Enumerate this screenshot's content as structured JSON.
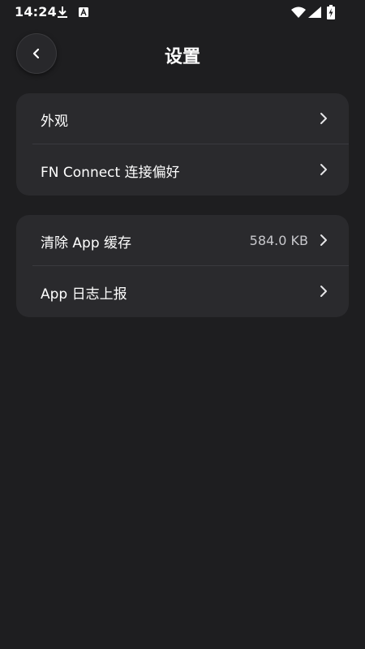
{
  "status_bar": {
    "time": "14:24",
    "icons": [
      "download-icon",
      "a-icon",
      "wifi-icon",
      "signal-icon",
      "battery-charging-icon"
    ]
  },
  "header": {
    "title": "设置",
    "back_icon": "chevron-left-icon"
  },
  "groups": [
    {
      "items": [
        {
          "label": "外观"
        },
        {
          "label": "FN Connect 连接偏好"
        }
      ]
    },
    {
      "items": [
        {
          "label": "清除 App 缓存",
          "value": "584.0 KB"
        },
        {
          "label": "App 日志上报"
        }
      ]
    }
  ],
  "colors": {
    "background": "#1e1e20",
    "card": "#2a2a2d",
    "text": "#ffffff",
    "secondary_text": "#c8c8cc"
  }
}
